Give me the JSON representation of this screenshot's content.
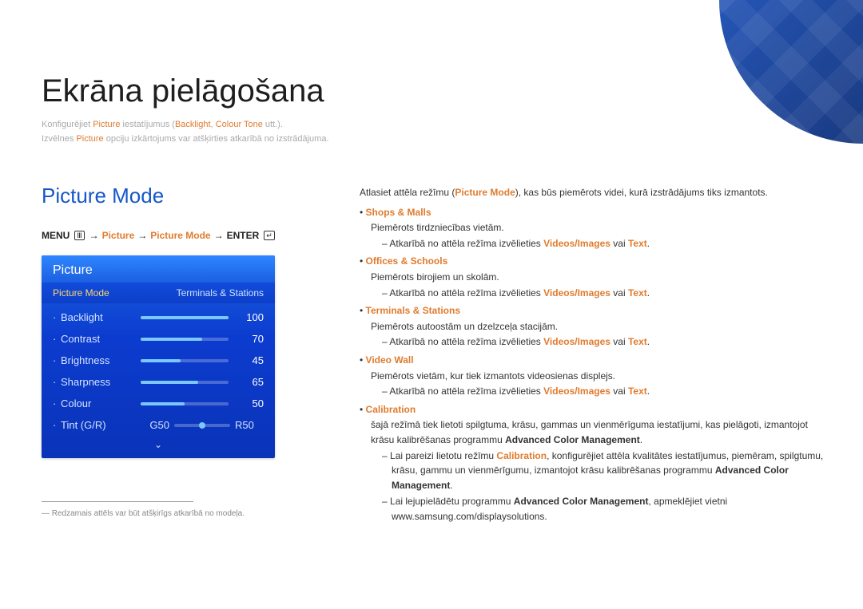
{
  "chapter_title": "Ekrāna pielāgošana",
  "intro": {
    "line1_a": "Konfigurējiet ",
    "line1_b": "Picture",
    "line1_c": " iestatījumus (",
    "line1_d": "Backlight",
    "line1_e": ", ",
    "line1_f": "Colour Tone",
    "line1_g": " utt.).",
    "line2_a": "Izvēlnes ",
    "line2_b": "Picture",
    "line2_c": " opciju izkārtojums var atšķirties atkarībā no izstrādājuma."
  },
  "section_title": "Picture Mode",
  "breadcrumb": {
    "menu": "MENU",
    "menu_glyph": "Ⅲ",
    "arrow": "→",
    "p1": "Picture",
    "p2": "Picture Mode",
    "enter": "ENTER",
    "enter_glyph": "↵"
  },
  "osd": {
    "header": "Picture",
    "tab_left": "Picture Mode",
    "tab_right": "Terminals & Stations",
    "rows": [
      {
        "label": "Backlight",
        "value": "100",
        "pct": 100
      },
      {
        "label": "Contrast",
        "value": "70",
        "pct": 70
      },
      {
        "label": "Brightness",
        "value": "45",
        "pct": 45
      },
      {
        "label": "Sharpness",
        "value": "65",
        "pct": 65
      },
      {
        "label": "Colour",
        "value": "50",
        "pct": 50
      }
    ],
    "tint": {
      "label": "Tint (G/R)",
      "left": "G50",
      "right": "R50",
      "knob_pct": 50
    },
    "arrow_glyph": "⌄"
  },
  "footnote": "― Redzamais attēls var būt atšķirīgs atkarībā no modeļa.",
  "body": {
    "lead_a": "Atlasiet attēla režīmu (",
    "lead_b": "Picture Mode",
    "lead_c": "), kas būs piemērots videi, kurā izstrādājums tiks izmantots.",
    "modes": [
      {
        "name": "Shops & Malls",
        "desc": "Piemērots tirdzniecības vietām.",
        "sub_a": "Atkarībā no attēla režīma izvēlieties ",
        "sub_b": "Videos/Images",
        "sub_c": " vai ",
        "sub_d": "Text",
        "sub_e": "."
      },
      {
        "name": "Offices & Schools",
        "desc": "Piemērots birojiem un skolām.",
        "sub_a": "Atkarībā no attēla režīma izvēlieties ",
        "sub_b": "Videos/Images",
        "sub_c": " vai ",
        "sub_d": "Text",
        "sub_e": "."
      },
      {
        "name": "Terminals & Stations",
        "desc": "Piemērots autoostām un dzelzceļa stacijām.",
        "sub_a": "Atkarībā no attēla režīma izvēlieties ",
        "sub_b": "Videos/Images",
        "sub_c": " vai ",
        "sub_d": "Text",
        "sub_e": "."
      },
      {
        "name": "Video Wall",
        "desc": "Piemērots vietām, kur tiek izmantots videosienas displejs.",
        "sub_a": "Atkarībā no attēla režīma izvēlieties ",
        "sub_b": "Videos/Images",
        "sub_c": " vai ",
        "sub_d": "Text",
        "sub_e": "."
      }
    ],
    "calibration": {
      "name": "Calibration",
      "desc_a": "šajā režīmā tiek lietoti spilgtuma, krāsu, gammas un vienmērīguma iestatījumi, kas pielāgoti, izmantojot krāsu kalibrēšanas programmu ",
      "desc_b": "Advanced Color Management",
      "desc_c": ".",
      "sub1_a": "Lai pareizi lietotu režīmu ",
      "sub1_b": "Calibration",
      "sub1_c": ", konfigurējiet attēla kvalitātes iestatījumus, piemēram, spilgtumu, krāsu, gammu un vienmērīgumu, izmantojot krāsu kalibrēšanas programmu ",
      "sub1_d": "Advanced Color Management",
      "sub1_e": ".",
      "sub2_a": "Lai lejupielādētu programmu ",
      "sub2_b": "Advanced Color Management",
      "sub2_c": ", apmeklējiet vietni www.samsung.com/displaysolutions."
    }
  }
}
